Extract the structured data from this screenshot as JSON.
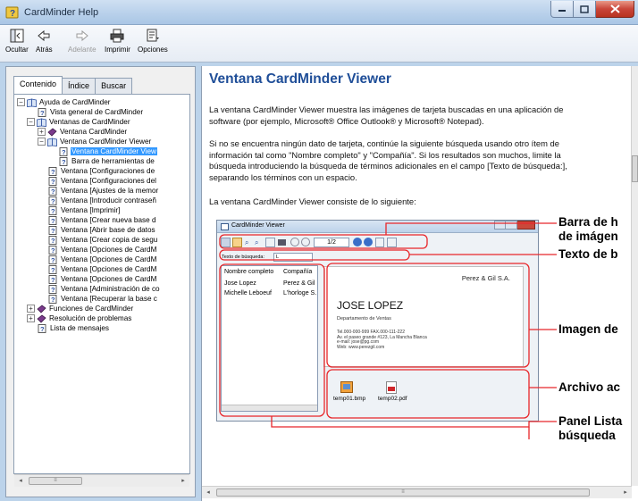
{
  "window": {
    "title": "CardMinder Help"
  },
  "toolbar": {
    "hide": "Ocultar",
    "back": "Atrás",
    "forward": "Adelante",
    "print": "Imprimir",
    "options": "Opciones"
  },
  "tabs": [
    "Contenido",
    "Índice",
    "Buscar"
  ],
  "tree": [
    {
      "label": "Ayuda de CardMinder"
    },
    {
      "label": "Vista general de CardMinder"
    },
    {
      "label": "Ventanas de CardMinder"
    },
    {
      "label": "Ventana CardMinder"
    },
    {
      "label": "Ventana CardMinder Viewer"
    },
    {
      "label": "Ventana CardMinder View"
    },
    {
      "label": "Barra de herramientas de"
    },
    {
      "label": "Ventana [Configuraciones de"
    },
    {
      "label": "Ventana [Configuraciones del"
    },
    {
      "label": "Ventana [Ajustes de la memor"
    },
    {
      "label": "Ventana [Introducir contraseñ"
    },
    {
      "label": "Ventana [Imprimir]"
    },
    {
      "label": "Ventana [Crear nueva base d"
    },
    {
      "label": "Ventana [Abrir base de datos"
    },
    {
      "label": "Ventana [Crear copia de segu"
    },
    {
      "label": "Ventana [Opciones de CardM"
    },
    {
      "label": "Ventana [Opciones de CardM"
    },
    {
      "label": "Ventana [Opciones de CardM"
    },
    {
      "label": "Ventana [Opciones de CardM"
    },
    {
      "label": "Ventana [Administración de co"
    },
    {
      "label": "Ventana [Recuperar la base c"
    },
    {
      "label": "Funciones de CardMinder"
    },
    {
      "label": "Resolución de problemas"
    },
    {
      "label": "Lista de mensajes"
    }
  ],
  "page": {
    "title": "Ventana CardMinder Viewer",
    "p1a": "La ventana CardMinder Viewer muestra las imágenes de tarjeta buscadas en una aplicación de",
    "p1b": "software (por ejemplo, Microsoft® Office Outlook® y Microsoft® Notepad).",
    "p2a": "Si no se encuentra ningún dato de tarjeta, continúe la siguiente búsqueda usando otro ítem de",
    "p2b": "información tal como \"Nombre completo\" y \"Compañía\". Si los resultados son muchos, limite la",
    "p2c": "búsqueda introduciendo la búsqueda de términos adicionales en el campo [Texto de búsqueda:],",
    "p2d": "separando los términos con un espacio.",
    "p3": "La ventana CardMinder Viewer consiste de lo siguiente:"
  },
  "viewer": {
    "title": "CardMinder Viewer",
    "page_box": "1/2",
    "search_label": "Texto de búsqueda:",
    "search_value": "L",
    "columns": [
      "Nombre completo",
      "Compañía"
    ],
    "rows": [
      {
        "name": "Jose Lopez",
        "company": "Perez & Gil"
      },
      {
        "name": "Michelle Leboeuf",
        "company": "L'horloge S."
      }
    ],
    "card": {
      "company": "Perez & Gil S.A.",
      "name": "JOSE LOPEZ",
      "dept": "Departamento de Ventas",
      "line1": "Tel.000-000-999   FAX.000-111-222",
      "line2": "Av. el paseo grande #123, La Mancha Blanca",
      "line3": "e-mail: jose@pg.com",
      "line4": "Web: www.perezgil.com"
    },
    "files": [
      "temp01.bmp",
      "temp02.pdf"
    ]
  },
  "callouts": {
    "c1a": "Barra de h",
    "c1b": "de imágen",
    "c2": "Texto de b",
    "c3": "Imagen de",
    "c4": "Archivo ac",
    "c5a": "Panel Lista",
    "c5b": "búsqueda"
  },
  "colors": {
    "heading": "#1f4e98",
    "callout": "#e8262a",
    "selected": "#3399ff"
  },
  "icons": [
    "help-book-icon",
    "hide-pane-icon",
    "back-arrow-icon",
    "forward-arrow-icon",
    "printer-icon",
    "options-icon"
  ]
}
